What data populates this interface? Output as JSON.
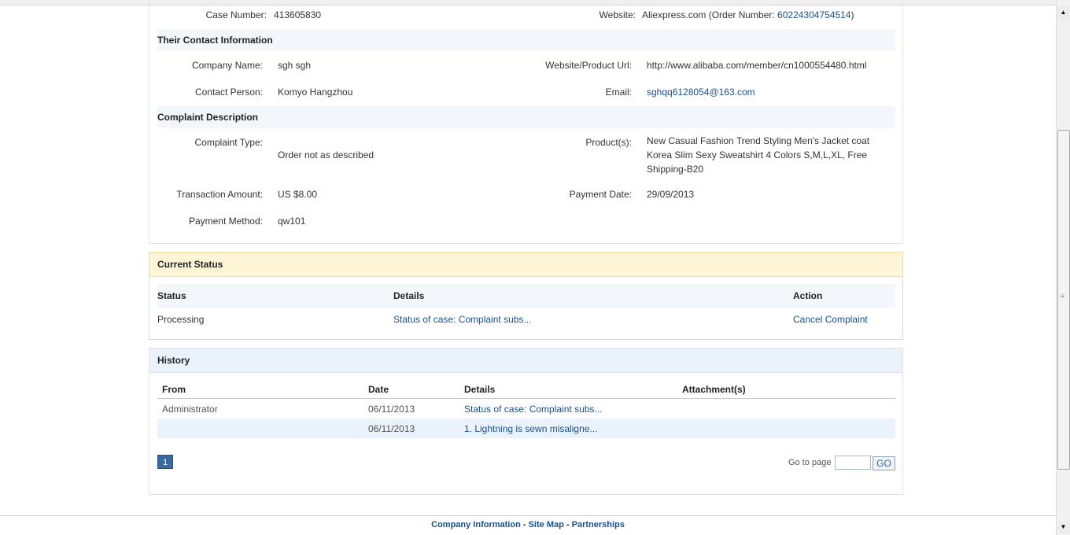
{
  "case": {
    "case_number_label": "Case Number:",
    "case_number": "413605830",
    "website_label": "Website:",
    "website_value": "Aliexpress.com (Order Number: ",
    "order_number": "60224304754514",
    "website_suffix": ")"
  },
  "contact": {
    "section_title": "Their Contact Information",
    "company_name_label": "Company Name:",
    "company_name": "sgh sgh",
    "product_url_label": "Website/Product Url:",
    "product_url": "http://www.alibaba.com/member/cn1000554480.html",
    "contact_person_label": "Contact Person:",
    "contact_person": "Komyo Hangzhou",
    "email_label": "Email:",
    "email": "sghqq6128054@163.com"
  },
  "complaint": {
    "section_title": "Complaint Description",
    "type_label": "Complaint Type:",
    "type_value": "Order not as described",
    "products_label": "Product(s):",
    "product_line1": "New Casual Fashion Trend Styling Men's Jacket coat",
    "product_line2": "Korea Slim Sexy Sweatshirt 4 Colors S,M,L,XL, Free",
    "product_line3": "Shipping-B20",
    "amount_label": "Transaction Amount:",
    "amount_value": "US $8.00",
    "payment_date_label": "Payment Date:",
    "payment_date": "29/09/2013",
    "payment_method_label": "Payment Method:",
    "payment_method": "qw101"
  },
  "current_status": {
    "title": "Current Status",
    "col_status": "Status",
    "col_details": "Details",
    "col_action": "Action",
    "status": "Processing",
    "details_link": "Status of case: Complaint subs...",
    "action_link": "Cancel Complaint"
  },
  "history": {
    "title": "History",
    "col_from": "From",
    "col_date": "Date",
    "col_details": "Details",
    "col_attachments": "Attachment(s)",
    "rows": [
      {
        "from": "Administrator",
        "date": "06/11/2013",
        "details": "Status of case: Complaint subs..."
      },
      {
        "from": "",
        "date": "06/11/2013",
        "details": "1. Lightning is sewn misaligne..."
      }
    ],
    "current_page": "1",
    "goto_label": "Go to page",
    "go_button": "GO"
  },
  "footer": {
    "company_info": "Company Information",
    "site_map": "Site Map",
    "partnerships": "Partnerships",
    "separator": "-"
  },
  "colors": {
    "link": "#1a4f8c",
    "status_header_bg": "#fdf5d6",
    "history_header_bg": "#eaf2fb",
    "pager_active": "#3a6aa3"
  },
  "icons": {
    "scroll_up": "triangle-up-icon",
    "scroll_down": "triangle-down-icon"
  }
}
